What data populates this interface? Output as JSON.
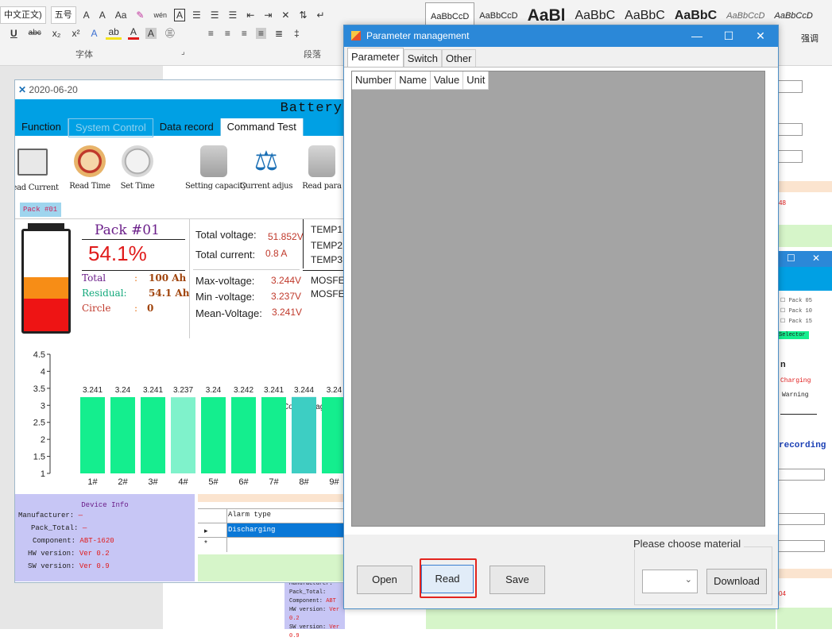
{
  "ribbon": {
    "font_name": "中文正文)",
    "font_size": "五号",
    "grow_font": "A",
    "shrink_font": "A",
    "change_case": "Aa",
    "clear_format": "✎",
    "phonetic": "wén",
    "char_border": "A",
    "group_font_label": "字体",
    "group_paragraph_label": "段落",
    "emphasis_style_label": "强调",
    "styles": [
      "AaBbCcD",
      "AaBbCcD",
      "AaBl",
      "AaBbC",
      "AaBbC",
      "AaBbC",
      "AaBbCcD",
      "AaBbCcD"
    ]
  },
  "battery_app": {
    "title_date": "2020-06-20",
    "banner_title": "Battery",
    "menu": [
      "Function",
      "System Control",
      "Data record",
      "Command Test"
    ],
    "tools": [
      "Read Current",
      "Read Time",
      "Set Time",
      "Setting capacity",
      "Current adjus",
      "Read para"
    ],
    "pack_tab": "Pack #01",
    "pack_label": "Pack #01",
    "soc": "54.1%",
    "soc_fraction": 0.541,
    "total_label": "Total",
    "total_value": "100 Ah",
    "residual_label": "Residual:",
    "residual_value": "54.1 Ah",
    "circle_label": "Circle",
    "circle_value": "0",
    "colon": ":",
    "total_voltage_label": "Total voltage:",
    "total_voltage_value": "51.852V",
    "total_current_label": "Total current:",
    "total_current_value": "0.8 A",
    "max_voltage_label": "Max-voltage:",
    "max_voltage_value": "3.244V",
    "min_voltage_label": "Min -voltage:",
    "min_voltage_value": "3.237V",
    "mean_voltage_label": "Mean-Voltage:",
    "mean_voltage_value": "3.241V",
    "temps": [
      "TEMP1",
      "TEMP2",
      "TEMP3"
    ],
    "mosfets": [
      "MOSFE",
      "MOSFE"
    ],
    "device_info": {
      "heading": "Device Info",
      "manufacturer_label": "Manufacturer:",
      "manufacturer_value": "—",
      "pack_total_label": "Pack_Total:",
      "pack_total_value": "—",
      "component_label": "Component:",
      "component_value": "ABT-1620",
      "hw_label": "HW version:",
      "hw_value": "Ver 0.2",
      "sw_label": "SW version:",
      "sw_value": "Ver 0.9"
    },
    "alarm_table": {
      "header": "Alarm type",
      "row1": "Discharging",
      "row1_marker": "▸",
      "row2_marker": "*"
    }
  },
  "chart_data": {
    "type": "bar",
    "title": "",
    "legend": [
      "Core Voltage(V)"
    ],
    "legend_position": "top-right",
    "categories": [
      "1#",
      "2#",
      "3#",
      "4#",
      "5#",
      "6#",
      "7#",
      "8#",
      "9#"
    ],
    "values": [
      3.241,
      3.24,
      3.241,
      3.237,
      3.24,
      3.242,
      3.241,
      3.244,
      3.24
    ],
    "ylim": [
      1,
      4.5
    ],
    "yticks": [
      "1",
      "1.5",
      "2",
      "2.5",
      "3",
      "3.5",
      "4",
      "4.5"
    ],
    "colors": [
      "#14ee8e",
      "#14ee8e",
      "#14ee8e",
      "#7ff2cb",
      "#14ee8e",
      "#14ee8e",
      "#14ee8e",
      "#3dcec3",
      "#14ee8e"
    ],
    "grid": false
  },
  "dialog": {
    "title": "Parameter management",
    "minimize": "—",
    "maximize": "☐",
    "close": "✕",
    "tabs": [
      "Parameter",
      "Switch",
      "Other"
    ],
    "columns": [
      "Number",
      "Name",
      "Value",
      "Unit"
    ],
    "open_label": "Open",
    "read_label": "Read",
    "save_label": "Save",
    "material_group_label": "Please choose material",
    "material_selected": "",
    "download_label": "Download"
  },
  "right_window": {
    "checkboxes": [
      "Pack 05",
      "Pack 10",
      "Pack 15"
    ],
    "selector_label": "Selector",
    "n_label": "n",
    "charging_label": "Charging",
    "warning_label": "Warning",
    "recording_label": "recording",
    "value_48": "48",
    "value_04": "04"
  },
  "background_device_info": {
    "manufacturer_label": "Manufacturer:",
    "pack_total_label": "Pack_Total:",
    "component_label": "Component:",
    "component_value": "ABT",
    "hw_label": "HW version:",
    "hw_value": "Ver 0.2",
    "sw_label": "SW version:",
    "sw_value": "Ver 0.9"
  },
  "colors": {
    "accent_blue": "#00a0e4",
    "dialog_title": "#2b88d8",
    "highlight_red": "#e3241e",
    "bar_green": "#14ee8e",
    "device_panel": "#c7c6f5",
    "grid_gray": "#a4a4a4"
  }
}
